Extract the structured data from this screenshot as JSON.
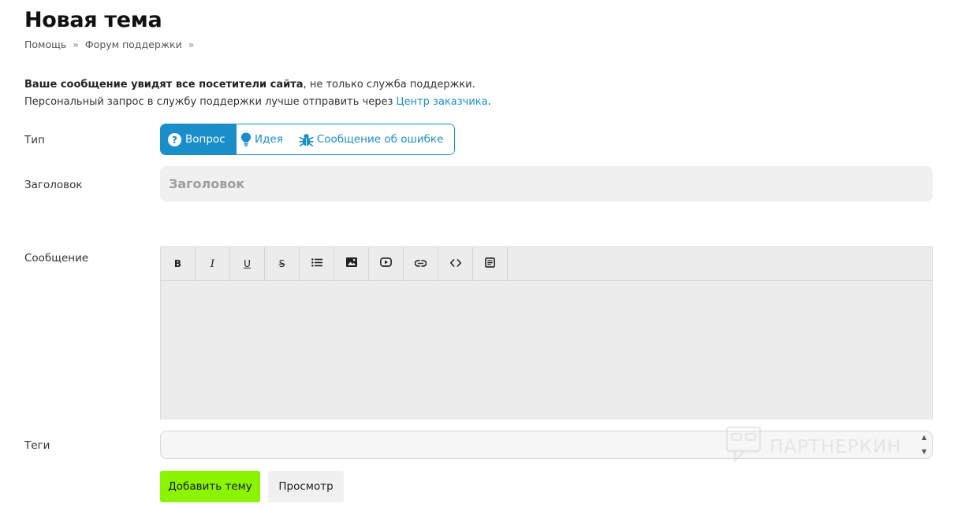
{
  "page": {
    "title": "Новая тема"
  },
  "breadcrumb": {
    "items": [
      "Помощь",
      "Форум поддержки"
    ],
    "separator": "»"
  },
  "notice": {
    "bold": "Ваше сообщение увидят все посетители сайта",
    "rest": ", не только служба поддержки.",
    "line2_prefix": "Персональный запрос в службу поддержки лучше отправить через ",
    "link": "Центр заказчика",
    "line2_suffix": "."
  },
  "form": {
    "type_label": "Тип",
    "types": [
      {
        "label": "Вопрос",
        "icon": "question-icon",
        "active": true
      },
      {
        "label": "Идея",
        "icon": "lightbulb-icon",
        "active": false
      },
      {
        "label": "Сообщение об ошибке",
        "icon": "bug-icon",
        "active": false
      }
    ],
    "title_label": "Заголовок",
    "title_placeholder": "Заголовок",
    "message_label": "Сообщение",
    "toolbar": [
      "B",
      "I",
      "U",
      "S"
    ],
    "tags_label": "Теги",
    "submit_label": "Добавить тему",
    "preview_label": "Просмотр"
  },
  "watermark": {
    "text": "ПАРТНЕРКИН"
  },
  "colors": {
    "accent": "#1a8ec9",
    "submit": "#8bf400"
  }
}
